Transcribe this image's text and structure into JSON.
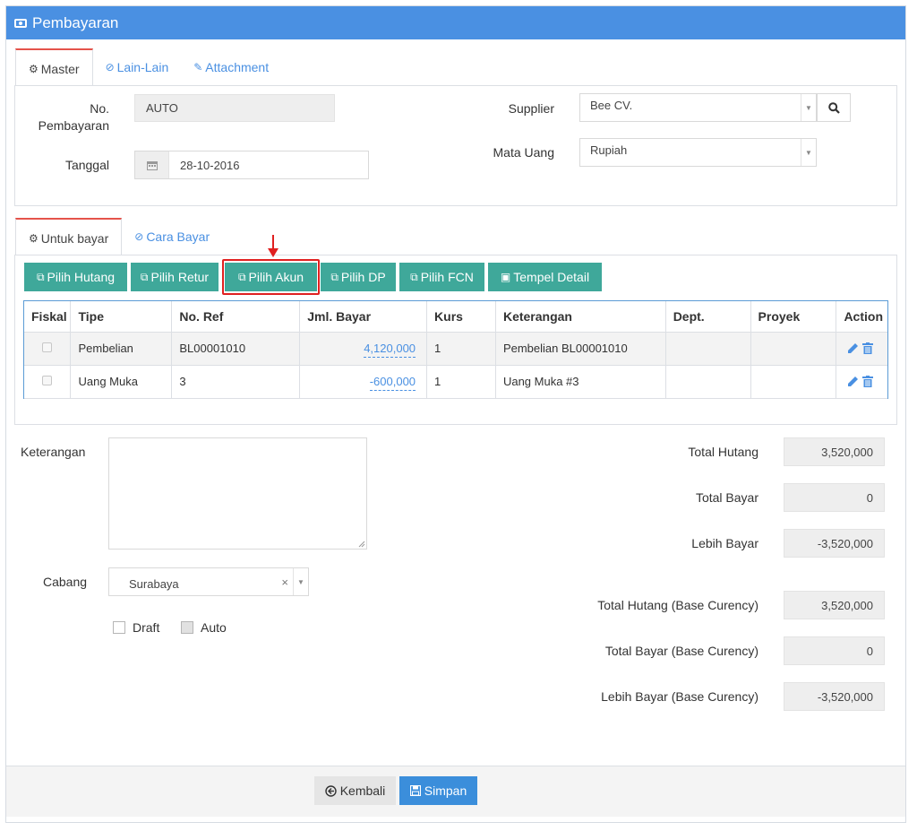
{
  "window": {
    "title": "Pembayaran"
  },
  "tabs_top": [
    {
      "label": "Master",
      "active": true
    },
    {
      "label": "Lain-Lain",
      "active": false
    },
    {
      "label": "Attachment",
      "active": false
    }
  ],
  "master": {
    "no_pembayaran_label": "No. Pembayaran",
    "no_pembayaran_value": "AUTO",
    "tanggal_label": "Tanggal",
    "tanggal_value": "28-10-2016",
    "supplier_label": "Supplier",
    "supplier_value": "Bee CV.",
    "mata_uang_label": "Mata Uang",
    "mata_uang_value": "Rupiah"
  },
  "tabs_detail": [
    {
      "label": "Untuk bayar",
      "active": true
    },
    {
      "label": "Cara Bayar",
      "active": false
    }
  ],
  "toolbar": {
    "pilih_hutang": "Pilih Hutang",
    "pilih_retur": "Pilih Retur",
    "pilih_akun": "Pilih Akun",
    "pilih_dp": "Pilih DP",
    "pilih_fcn": "Pilih FCN",
    "tempel_detail": "Tempel Detail"
  },
  "table": {
    "headers": [
      "Fiskal",
      "Tipe",
      "No. Ref",
      "Jml. Bayar",
      "Kurs",
      "Keterangan",
      "Dept.",
      "Proyek",
      "Action"
    ],
    "rows": [
      {
        "tipe": "Pembelian",
        "no_ref": "BL00001010",
        "jml_bayar": "4,120,000",
        "kurs": "1",
        "keterangan": "Pembelian BL00001010",
        "dept": "",
        "proyek": ""
      },
      {
        "tipe": "Uang Muka",
        "no_ref": "3",
        "jml_bayar": "-600,000",
        "kurs": "1",
        "keterangan": "Uang Muka #3",
        "dept": "",
        "proyek": ""
      }
    ]
  },
  "bottom": {
    "keterangan_label": "Keterangan",
    "keterangan_value": "",
    "cabang_label": "Cabang",
    "cabang_value": "Surabaya",
    "draft_label": "Draft",
    "auto_label": "Auto"
  },
  "summary": {
    "total_hutang_label": "Total Hutang",
    "total_hutang": "3,520,000",
    "total_bayar_label": "Total Bayar",
    "total_bayar": "0",
    "lebih_bayar_label": "Lebih Bayar",
    "lebih_bayar": "-3,520,000",
    "total_hutang_base_label": "Total Hutang (Base Curency)",
    "total_hutang_base": "3,520,000",
    "total_bayar_base_label": "Total Bayar (Base Curency)",
    "total_bayar_base": "0",
    "lebih_bayar_base_label": "Lebih Bayar (Base Curency)",
    "lebih_bayar_base": "-3,520,000"
  },
  "footer": {
    "kembali": "Kembali",
    "simpan": "Simpan"
  },
  "colors": {
    "header": "#4a90e2",
    "toolbar": "#3fa89a",
    "save": "#3b8edb",
    "highlight": "#e02020"
  }
}
